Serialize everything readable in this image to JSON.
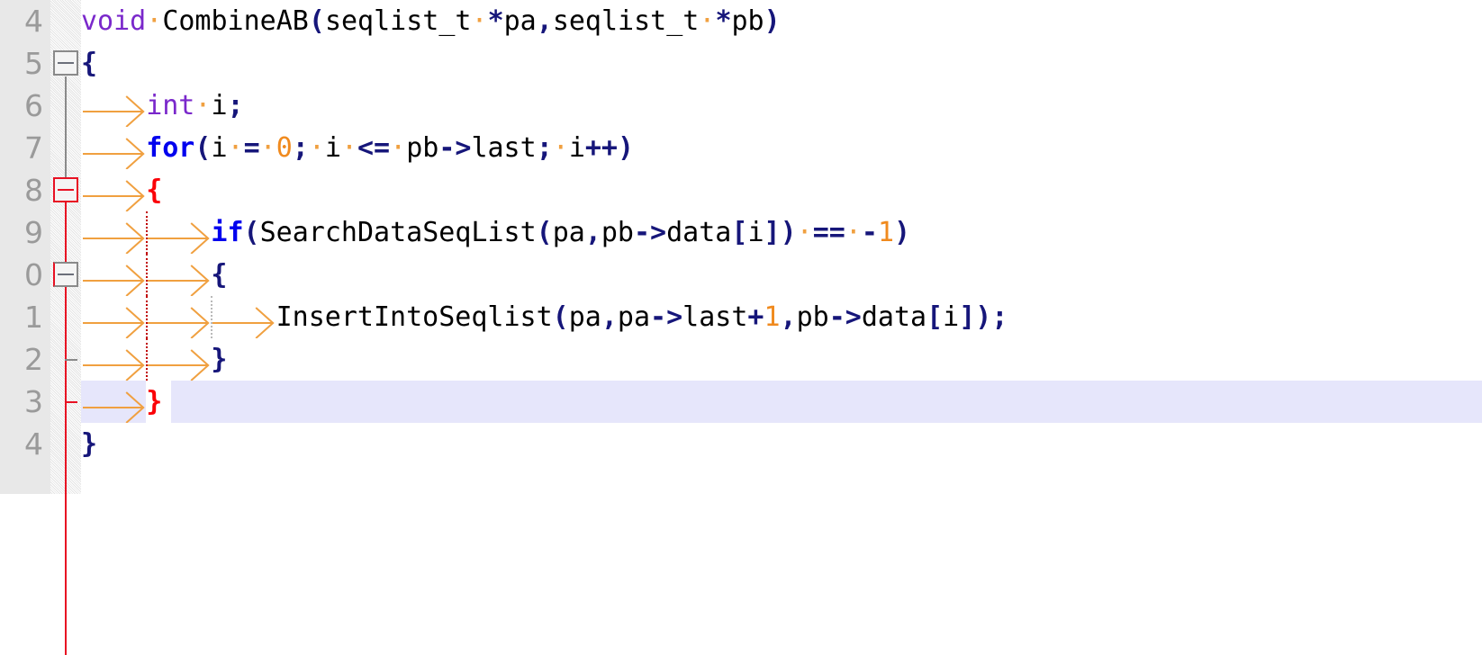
{
  "editor": {
    "language": "C",
    "font_size_px": 30,
    "line_height_px": 47,
    "colors": {
      "background": "#ffffff",
      "gutter_background": "#e8e8e8",
      "linenumber_text": "#9a9a9a",
      "current_line_highlight": "#e6e6fb",
      "keyword_type": "#7a28cb",
      "keyword_control": "#0000ee",
      "operator": "#16167a",
      "number": "#f08a1e",
      "identifier": "#000000",
      "brace_matched": "#fb0007",
      "tab_arrow": "#f0a040",
      "indent_guide_active": "#c00000",
      "indent_guide": "#b9b9b9",
      "fold_marker_active": "#e81123",
      "fold_marker": "#8a8a8a"
    }
  },
  "lines": [
    {
      "number": "4",
      "fold": "none",
      "highlight": false,
      "tabs": 0,
      "tokens": [
        {
          "t": "void",
          "c": "kw"
        },
        {
          "t": "·",
          "c": "sp"
        },
        {
          "t": "CombineAB",
          "c": "id"
        },
        {
          "t": "(",
          "c": "op"
        },
        {
          "t": "seqlist_t",
          "c": "id"
        },
        {
          "t": "·",
          "c": "sp"
        },
        {
          "t": "*",
          "c": "op"
        },
        {
          "t": "pa",
          "c": "id"
        },
        {
          "t": ",",
          "c": "op"
        },
        {
          "t": "seqlist_t",
          "c": "id"
        },
        {
          "t": "·",
          "c": "sp"
        },
        {
          "t": "*",
          "c": "op"
        },
        {
          "t": "pb",
          "c": "id"
        },
        {
          "t": ")",
          "c": "op"
        }
      ]
    },
    {
      "number": "5",
      "fold": "open",
      "highlight": false,
      "tabs": 0,
      "tokens": [
        {
          "t": "{",
          "c": "brace-navy"
        }
      ]
    },
    {
      "number": "6",
      "fold": "line",
      "highlight": false,
      "tabs": 1,
      "tokens": [
        {
          "t": "int",
          "c": "kw"
        },
        {
          "t": "·",
          "c": "sp"
        },
        {
          "t": "i",
          "c": "id"
        },
        {
          "t": ";",
          "c": "op"
        }
      ]
    },
    {
      "number": "7",
      "fold": "line",
      "highlight": false,
      "tabs": 1,
      "tokens": [
        {
          "t": "for",
          "c": "kw2"
        },
        {
          "t": "(",
          "c": "op"
        },
        {
          "t": "i",
          "c": "id"
        },
        {
          "t": "·",
          "c": "sp"
        },
        {
          "t": "=",
          "c": "op"
        },
        {
          "t": "·",
          "c": "sp"
        },
        {
          "t": "0",
          "c": "num"
        },
        {
          "t": ";",
          "c": "op"
        },
        {
          "t": "·",
          "c": "sp"
        },
        {
          "t": "i",
          "c": "id"
        },
        {
          "t": "·",
          "c": "sp"
        },
        {
          "t": "<=",
          "c": "op"
        },
        {
          "t": "·",
          "c": "sp"
        },
        {
          "t": "pb",
          "c": "id"
        },
        {
          "t": "->",
          "c": "op"
        },
        {
          "t": "last",
          "c": "id"
        },
        {
          "t": ";",
          "c": "op"
        },
        {
          "t": "·",
          "c": "sp"
        },
        {
          "t": "i",
          "c": "id"
        },
        {
          "t": "++",
          "c": "op"
        },
        {
          "t": ")",
          "c": "op"
        }
      ]
    },
    {
      "number": "8",
      "fold": "open-active",
      "highlight": false,
      "tabs": 1,
      "tokens": [
        {
          "t": "{",
          "c": "brace-red"
        }
      ]
    },
    {
      "number": "9",
      "fold": "line-active",
      "highlight": false,
      "tabs": 2,
      "tokens": [
        {
          "t": "if",
          "c": "kw2"
        },
        {
          "t": "(",
          "c": "op"
        },
        {
          "t": "SearchDataSeqList",
          "c": "id"
        },
        {
          "t": "(",
          "c": "op"
        },
        {
          "t": "pa",
          "c": "id"
        },
        {
          "t": ",",
          "c": "op"
        },
        {
          "t": "pb",
          "c": "id"
        },
        {
          "t": "->",
          "c": "op"
        },
        {
          "t": "data",
          "c": "id"
        },
        {
          "t": "[",
          "c": "op"
        },
        {
          "t": "i",
          "c": "id"
        },
        {
          "t": "]",
          "c": "op"
        },
        {
          "t": ")",
          "c": "op"
        },
        {
          "t": "·",
          "c": "sp"
        },
        {
          "t": "==",
          "c": "op"
        },
        {
          "t": "·",
          "c": "sp"
        },
        {
          "t": "-",
          "c": "op"
        },
        {
          "t": "1",
          "c": "num"
        },
        {
          "t": ")",
          "c": "op"
        }
      ]
    },
    {
      "number": "0",
      "fold": "open-inner",
      "highlight": false,
      "tabs": 2,
      "tokens": [
        {
          "t": "{",
          "c": "brace-navy"
        }
      ]
    },
    {
      "number": "1",
      "fold": "line-active",
      "highlight": false,
      "tabs": 3,
      "tokens": [
        {
          "t": "InsertIntoSeqlist",
          "c": "id"
        },
        {
          "t": "(",
          "c": "op"
        },
        {
          "t": "pa",
          "c": "id"
        },
        {
          "t": ",",
          "c": "op"
        },
        {
          "t": "pa",
          "c": "id"
        },
        {
          "t": "->",
          "c": "op"
        },
        {
          "t": "last",
          "c": "id"
        },
        {
          "t": "+",
          "c": "op"
        },
        {
          "t": "1",
          "c": "num"
        },
        {
          "t": ",",
          "c": "op"
        },
        {
          "t": "pb",
          "c": "id"
        },
        {
          "t": "->",
          "c": "op"
        },
        {
          "t": "data",
          "c": "id"
        },
        {
          "t": "[",
          "c": "op"
        },
        {
          "t": "i",
          "c": "id"
        },
        {
          "t": "]",
          "c": "op"
        },
        {
          "t": ")",
          "c": "op"
        },
        {
          "t": ";",
          "c": "op"
        }
      ]
    },
    {
      "number": "2",
      "fold": "end-inner",
      "highlight": false,
      "tabs": 2,
      "tokens": [
        {
          "t": "}",
          "c": "brace-navy"
        }
      ]
    },
    {
      "number": "3",
      "fold": "end-active",
      "highlight": true,
      "tabs": 1,
      "tokens": [
        {
          "t": "}",
          "c": "brace-red"
        }
      ]
    },
    {
      "number": "4",
      "fold": "line-plain",
      "highlight": false,
      "tabs": 0,
      "tokens": [
        {
          "t": "}",
          "c": "brace-navy"
        }
      ]
    }
  ],
  "gutter": {
    "fold_boxes": [
      {
        "line_index": 1,
        "style": "gray"
      },
      {
        "line_index": 4,
        "style": "red"
      },
      {
        "line_index": 6,
        "style": "leftred"
      }
    ]
  }
}
